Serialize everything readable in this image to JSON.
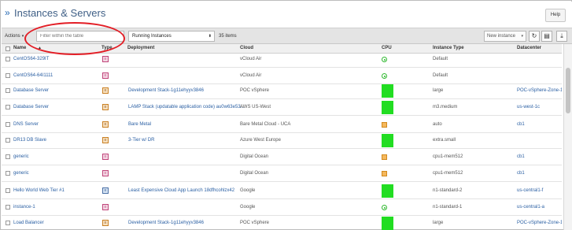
{
  "header": {
    "title": "Instances & Servers",
    "help_label": "Help"
  },
  "toolbar": {
    "actions_label": "Actions",
    "filter_placeholder": "Filter within the table",
    "view_select": "Running Instances",
    "count": "35 items",
    "new_instance_label": "New instance"
  },
  "columns": [
    "Name",
    "Type",
    "Deployment",
    "Cloud",
    "CPU",
    "Instance Type",
    "Datacenter"
  ],
  "rows": [
    {
      "name": "CentOS64-329IT",
      "type": "pink",
      "deployment": "",
      "cloud": "vCloud Air",
      "cpu": "ring",
      "cpu_level": 0,
      "instance_type": "Default",
      "datacenter": ""
    },
    {
      "name": "CentOS64-64I1111",
      "type": "pink",
      "deployment": "",
      "cloud": "vCloud Air",
      "cpu": "ring",
      "cpu_level": 0,
      "instance_type": "Default",
      "datacenter": ""
    },
    {
      "name": "Database Server",
      "type": "orange",
      "deployment": "Development Stack-1g11ehyyv3846",
      "cloud": "POC vSphere",
      "cpu": "bar",
      "cpu_level": 1.0,
      "instance_type": "large",
      "datacenter": "POC-vSphere-Zone-1"
    },
    {
      "name": "Database Server",
      "type": "orange",
      "deployment": "LAMP Stack (updatable application code) au0w63e53...",
      "cloud": "AWS US-West",
      "cpu": "bar",
      "cpu_level": 1.0,
      "instance_type": "m3.medium",
      "datacenter": "us-west-1c"
    },
    {
      "name": "DNS Server",
      "type": "orange",
      "deployment": "Bare Metal",
      "cloud": "Bare Metal Cloud - UCA",
      "cpu": "square",
      "cpu_level": 0.1,
      "instance_type": "auto",
      "datacenter": "cb1"
    },
    {
      "name": "DR13 DB Slave",
      "type": "orange",
      "deployment": "3-Tier w/ DR",
      "cloud": "Azure West Europe",
      "cpu": "bar",
      "cpu_level": 1.0,
      "instance_type": "extra.small",
      "datacenter": ""
    },
    {
      "name": "generic",
      "type": "pink",
      "deployment": "",
      "cloud": "Digital Ocean",
      "cpu": "square",
      "cpu_level": 0.1,
      "instance_type": "cpu1-mem512",
      "datacenter": "cb1"
    },
    {
      "name": "generic",
      "type": "pink",
      "deployment": "",
      "cloud": "Digital Ocean",
      "cpu": "square",
      "cpu_level": 0.1,
      "instance_type": "cpu1-mem512",
      "datacenter": "cb1"
    },
    {
      "name": "Hello World Web Tier #1",
      "type": "blue",
      "deployment": "Least Expensive Cloud App Launch 18dfhcohlzx42",
      "cloud": "Google",
      "cpu": "bar",
      "cpu_level": 1.0,
      "instance_type": "n1-standard-2",
      "datacenter": "us-central1-f"
    },
    {
      "name": "instance-1",
      "type": "pink",
      "deployment": "",
      "cloud": "Google",
      "cpu": "ring",
      "cpu_level": 0,
      "instance_type": "n1-standard-1",
      "datacenter": "us-central1-a"
    },
    {
      "name": "Load Balancer",
      "type": "orange",
      "deployment": "Development Stack-1g11ehyyv3846",
      "cloud": "POC vSphere",
      "cpu": "bar",
      "cpu_level": 1.0,
      "instance_type": "large",
      "datacenter": "POC-vSphere-Zone-1"
    }
  ],
  "colors": {
    "cpu_green": "#22dd22",
    "link": "#2a5fa3",
    "highlight_ring": "#e31e26"
  }
}
